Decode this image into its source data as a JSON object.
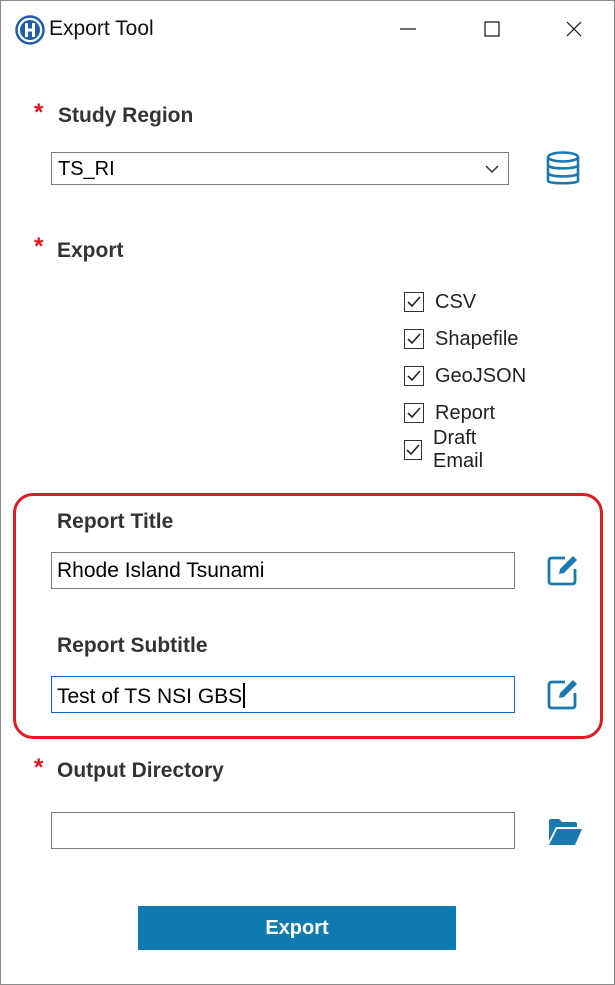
{
  "window": {
    "title": "Export Tool"
  },
  "study_region": {
    "label": "Study Region",
    "required_marker": "*",
    "selected_value": "TS_RI"
  },
  "export": {
    "label": "Export",
    "required_marker": "*",
    "options": [
      {
        "label": "CSV",
        "checked": true
      },
      {
        "label": "Shapefile",
        "checked": true
      },
      {
        "label": "GeoJSON",
        "checked": true
      },
      {
        "label": "Report",
        "checked": true
      },
      {
        "label": "Draft Email",
        "checked": true
      }
    ]
  },
  "report_title": {
    "label": "Report Title",
    "value": "Rhode Island Tsunami"
  },
  "report_subtitle": {
    "label": "Report Subtitle",
    "value": "Test of TS NSI GBS"
  },
  "output_directory": {
    "label": "Output Directory",
    "required_marker": "*",
    "value": ""
  },
  "export_button": {
    "label": "Export"
  },
  "icons": {
    "app": "hazus-h-logo-icon",
    "database": "database-icon",
    "edit": "edit-icon",
    "folder": "folder-open-icon"
  },
  "colors": {
    "accent": "#1a7ab0",
    "required": "#e3141a",
    "highlight": "#e01b24",
    "button_bg": "#0f7bb0"
  }
}
